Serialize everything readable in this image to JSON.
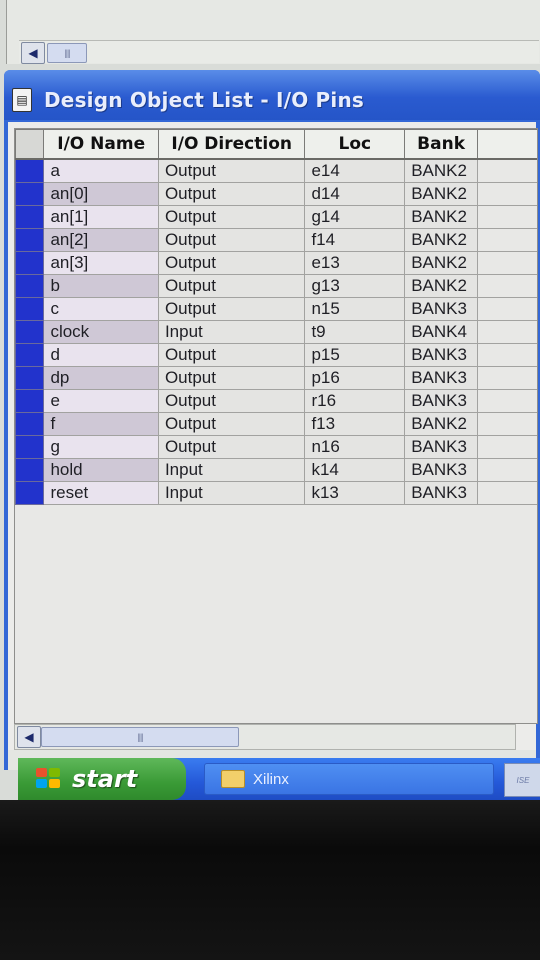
{
  "window": {
    "title": "Design Object List - I/O Pins"
  },
  "table": {
    "columns": [
      "I/O Name",
      "I/O Direction",
      "Loc",
      "Bank"
    ],
    "rows": [
      {
        "name": "a",
        "direction": "Output",
        "loc": "e14",
        "bank": "BANK2"
      },
      {
        "name": "an[0]",
        "direction": "Output",
        "loc": "d14",
        "bank": "BANK2"
      },
      {
        "name": "an[1]",
        "direction": "Output",
        "loc": "g14",
        "bank": "BANK2"
      },
      {
        "name": "an[2]",
        "direction": "Output",
        "loc": "f14",
        "bank": "BANK2"
      },
      {
        "name": "an[3]",
        "direction": "Output",
        "loc": "e13",
        "bank": "BANK2"
      },
      {
        "name": "b",
        "direction": "Output",
        "loc": "g13",
        "bank": "BANK2"
      },
      {
        "name": "c",
        "direction": "Output",
        "loc": "n15",
        "bank": "BANK3"
      },
      {
        "name": "clock",
        "direction": "Input",
        "loc": "t9",
        "bank": "BANK4"
      },
      {
        "name": "d",
        "direction": "Output",
        "loc": "p15",
        "bank": "BANK3"
      },
      {
        "name": "dp",
        "direction": "Output",
        "loc": "p16",
        "bank": "BANK3"
      },
      {
        "name": "e",
        "direction": "Output",
        "loc": "r16",
        "bank": "BANK3"
      },
      {
        "name": "f",
        "direction": "Output",
        "loc": "f13",
        "bank": "BANK2"
      },
      {
        "name": "g",
        "direction": "Output",
        "loc": "n16",
        "bank": "BANK3"
      },
      {
        "name": "hold",
        "direction": "Input",
        "loc": "k14",
        "bank": "BANK3"
      },
      {
        "name": "reset",
        "direction": "Input",
        "loc": "k13",
        "bank": "BANK3"
      }
    ]
  },
  "taskbar": {
    "start_label": "start",
    "task_label": "Xilinx",
    "tray_label": "ISE"
  },
  "icons": {
    "scroll_left": "arrow-left-icon",
    "title": "document-icon",
    "task": "folder-icon",
    "start": "windows-logo-icon"
  },
  "colors": {
    "titlebar": "#2a5bd0",
    "selector": "#2233cc",
    "start_button": "#3a9a36",
    "taskbar": "#2458d8"
  }
}
